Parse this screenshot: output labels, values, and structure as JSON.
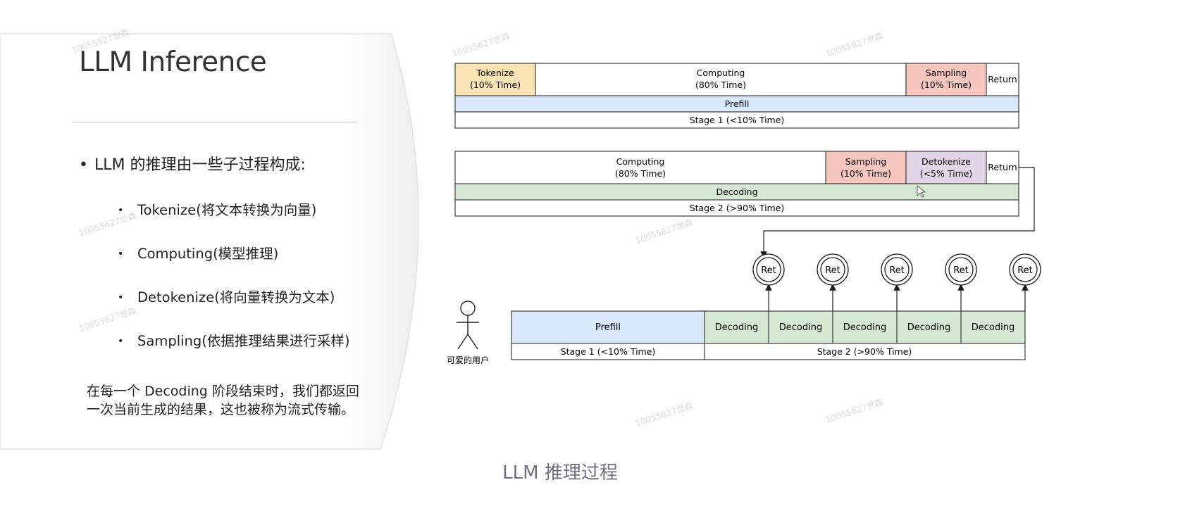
{
  "slide": {
    "title": "LLM Inference",
    "bullet_main": "LLM 的推理由一些子过程构成:",
    "sub_items": [
      "Tokenize(将文本转换为向量)",
      "Computing(模型推理)",
      "Detokenize(将向量转换为文本)",
      "Sampling(依据推理结果进行采样)"
    ],
    "paragraph": "在每一个 Decoding 阶段结束时，我们都返回一次当前生成的结果，这也被称为流式传输。",
    "caption": "LLM 推理过程",
    "watermark": "10055627世森"
  },
  "diagram": {
    "stage1": {
      "tokenize": [
        "Tokenize",
        "(10% Time)"
      ],
      "computing": [
        "Computing",
        "(80% Time)"
      ],
      "sampling": [
        "Sampling",
        "(10% Time)"
      ],
      "return": "Return",
      "phase": "Prefill",
      "stage": "Stage 1 (<10% Time)"
    },
    "stage2": {
      "computing": [
        "Computing",
        "(80% Time)"
      ],
      "sampling": [
        "Sampling",
        "(10% Time)"
      ],
      "detokenize": [
        "Detokenize",
        "(<5% Time)"
      ],
      "return": "Return",
      "phase": "Decoding",
      "stage": "Stage 2 (>90% Time)"
    },
    "timeline": {
      "user_label": "可爱的用户",
      "prefill": "Prefill",
      "decoding_steps": [
        "Decoding",
        "Decoding",
        "Decoding",
        "Decoding",
        "Decoding"
      ],
      "ret_label": "Ret",
      "stage1": "Stage 1 (<10% Time)",
      "stage2": "Stage 2 (>90% Time)"
    },
    "colors": {
      "tokenize": "#fbe5b6",
      "sampling": "#f7c6bf",
      "detokenize": "#e1d5e7",
      "prefill": "#dae8fc",
      "decoding": "#d5e8d4",
      "stroke": "#1a1a1a"
    }
  }
}
